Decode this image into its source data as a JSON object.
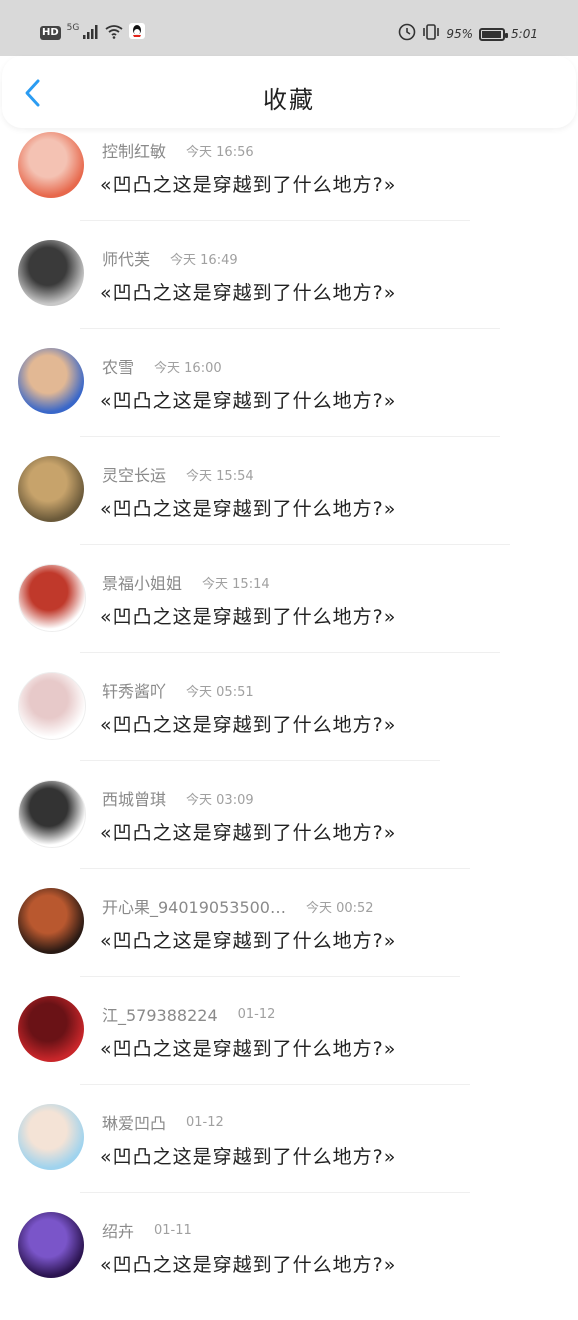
{
  "status_bar": {
    "hd": "HD",
    "network": "5G",
    "battery_percent": "95%",
    "battery_level": 0.95,
    "time": "5:01",
    "icons": [
      "signal-icon",
      "wifi-icon",
      "qq-icon",
      "alarm-icon",
      "vibrate-icon",
      "battery-icon"
    ]
  },
  "header": {
    "title": "收藏",
    "back_icon": "chevron-left-icon",
    "accent": "#2b9cf2"
  },
  "favorites": [
    {
      "name": "控制红敏",
      "time": "今天 16:56",
      "content": "«凹凸之这是穿越到了什么地方?»",
      "avatar_colors": [
        "#e7684c",
        "#f4c2b3"
      ]
    },
    {
      "name": "师代芙",
      "time": "今天 16:49",
      "content": "«凹凸之这是穿越到了什么地方?»",
      "avatar_colors": [
        "#c8c8c8",
        "#3a3a3a"
      ]
    },
    {
      "name": "农雪",
      "time": "今天 16:00",
      "content": "«凹凸之这是穿越到了什么地方?»",
      "avatar_colors": [
        "#3967c9",
        "#e2b894"
      ]
    },
    {
      "name": "灵空长运",
      "time": "今天 15:54",
      "content": "«凹凸之这是穿越到了什么地方?»",
      "avatar_colors": [
        "#6b5a3a",
        "#c7a36b"
      ]
    },
    {
      "name": "景福小姐姐",
      "time": "今天 15:14",
      "content": "«凹凸之这是穿越到了什么地方?»",
      "avatar_colors": [
        "#ffffff",
        "#c0392b"
      ]
    },
    {
      "name": "轩秀酱吖",
      "time": "今天 05:51",
      "content": "«凹凸之这是穿越到了什么地方?»",
      "avatar_colors": [
        "#ffffff",
        "#e7c9c9"
      ]
    },
    {
      "name": "西城曾琪",
      "time": "今天 03:09",
      "content": "«凹凸之这是穿越到了什么地方?»",
      "avatar_colors": [
        "#ffffff",
        "#333333"
      ]
    },
    {
      "name": "开心果_94019053500…",
      "time": "今天 00:52",
      "content": "«凹凸之这是穿越到了什么地方?»",
      "avatar_colors": [
        "#2a1a14",
        "#b9582f"
      ]
    },
    {
      "name": "江_579388224",
      "time": "01-12",
      "content": "«凹凸之这是穿越到了什么地方?»",
      "avatar_colors": [
        "#c8262a",
        "#6a1216"
      ]
    },
    {
      "name": "琳爱凹凸",
      "time": "01-12",
      "content": "«凹凸之这是穿越到了什么地方?»",
      "avatar_colors": [
        "#9fd3ee",
        "#f4e3d6"
      ]
    },
    {
      "name": "绍卉",
      "time": "01-11",
      "content": "«凹凸之这是穿越到了什么地方?»",
      "avatar_colors": [
        "#2b1450",
        "#7a55c9"
      ]
    }
  ]
}
